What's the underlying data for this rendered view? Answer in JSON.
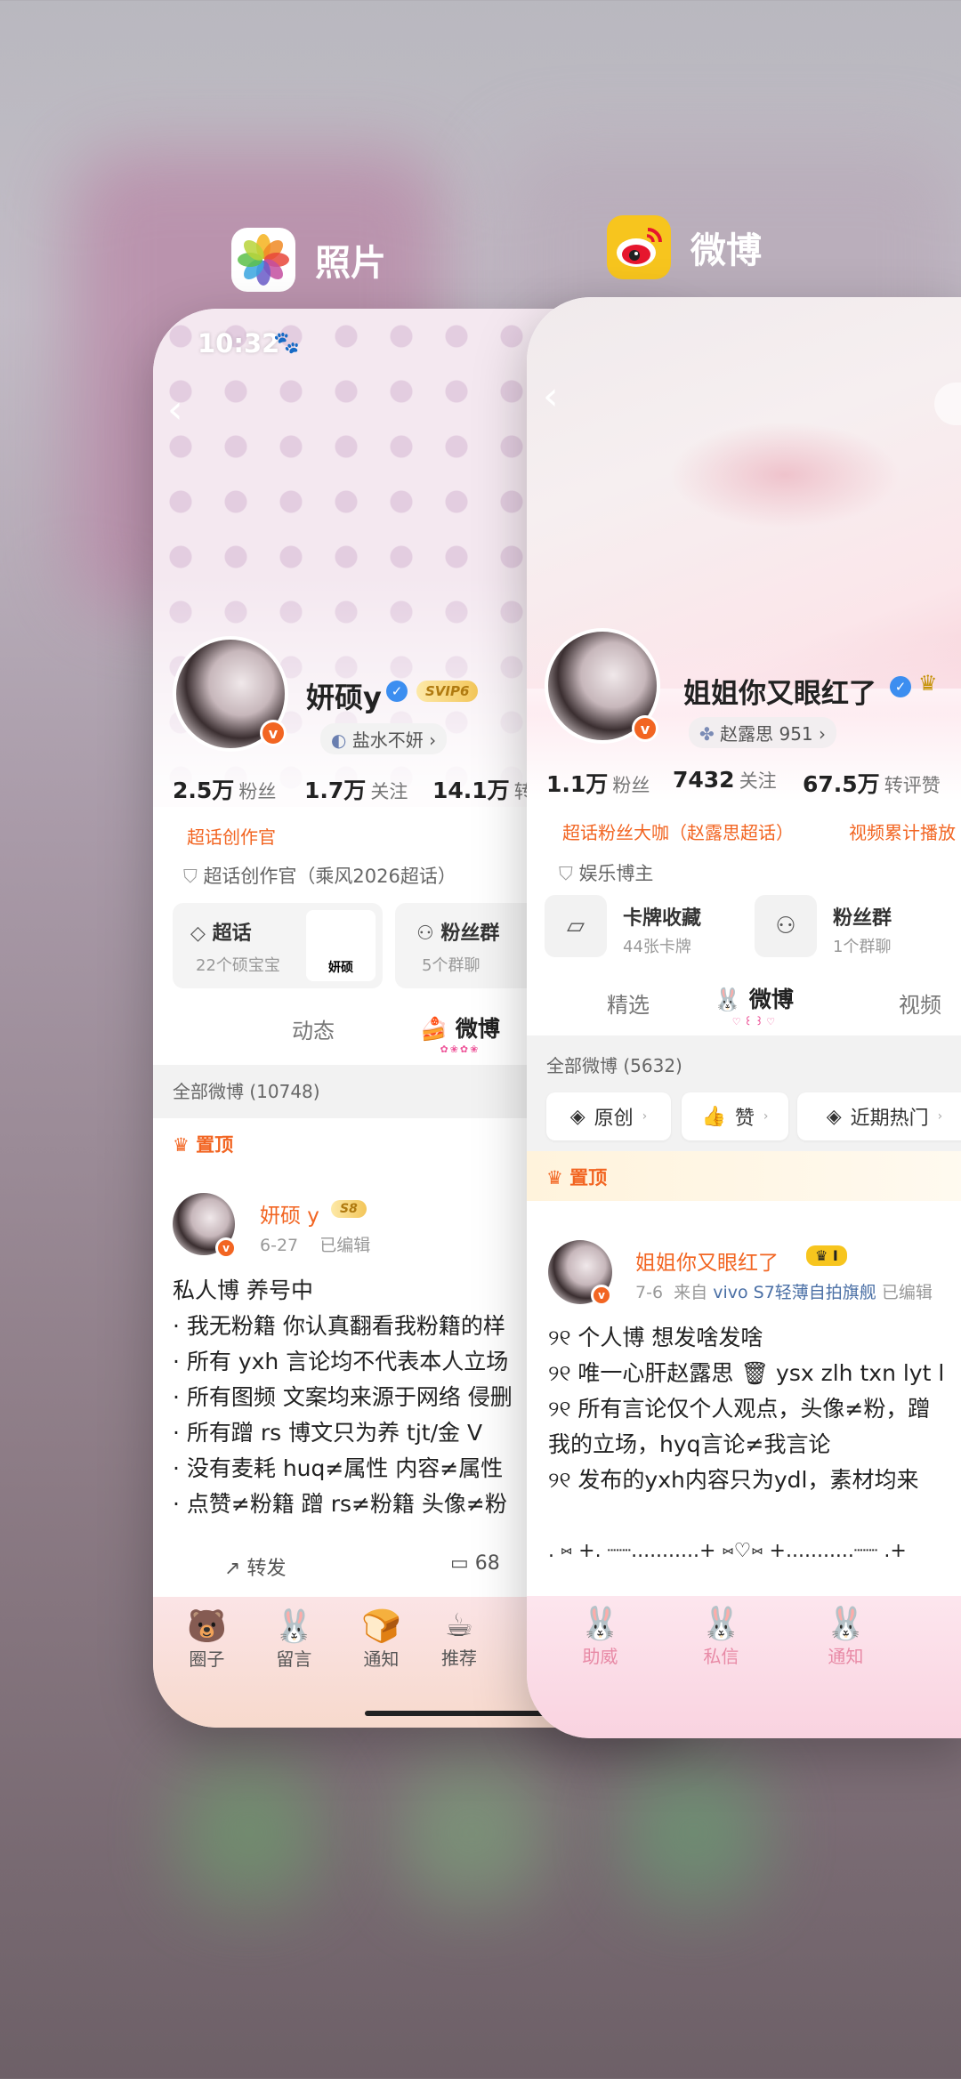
{
  "switcher": {
    "left_app_name": "照片",
    "right_app_name": "微博"
  },
  "left_card": {
    "status_time": "10:32",
    "profile": {
      "username": "妍硕y",
      "vip_badge": "SVIP6",
      "sub_link": "盐水不妍 ›",
      "stats": [
        {
          "value": "2.5万",
          "label": "粉丝"
        },
        {
          "value": "1.7万",
          "label": "关注"
        },
        {
          "value": "14.1万",
          "label": "转"
        }
      ],
      "tag": "超话创作官",
      "cert": "超话创作官（乘风2026超话）"
    },
    "cards": [
      {
        "title": "超话",
        "sub": "22个硕宝宝",
        "thumb": "妍硕"
      },
      {
        "title": "粉丝群",
        "sub": "5个群聊"
      }
    ],
    "tabs": [
      "动态",
      "微博"
    ],
    "all_weibo": "全部微博 (10748)",
    "pinned": "置顶",
    "post": {
      "author": "妍硕 y",
      "badge": "S8",
      "meta_date": "6-27",
      "meta_edited": "已编辑",
      "lines": [
        "私人博 养号中",
        "· 我无粉籍 你认真翻看我粉籍的样",
        "· 所有 yxh 言论均不代表本人立场",
        "· 所有图频 文案均来源于网络 侵删",
        "· 所有蹭 rs 博文只为养 tjt/金 V",
        "· 没有麦耗 huq≠属性 内容≠属性",
        "· 点赞≠粉籍 蹭 rs≠粉籍 头像≠粉"
      ],
      "repost_label": "转发",
      "comment_count": "68"
    },
    "bottom_nav": [
      "圈子",
      "留言",
      "通知",
      "推荐"
    ]
  },
  "right_card": {
    "profile": {
      "username": "姐姐你又眼红了",
      "sub_link": "赵露思 951 ›",
      "stats": [
        {
          "value": "1.1万",
          "label": "粉丝"
        },
        {
          "value": "7432",
          "label": "关注"
        },
        {
          "value": "67.5万",
          "label": "转评赞"
        }
      ],
      "tag1": "超话粉丝大咖（赵露思超话）",
      "tag2": "视频累计播放",
      "cert": "娱乐博主"
    },
    "cards": [
      {
        "title": "卡牌收藏",
        "sub": "44张卡牌"
      },
      {
        "title": "粉丝群",
        "sub": "1个群聊"
      }
    ],
    "tabs": [
      "精选",
      "微博",
      "视频"
    ],
    "all_weibo": "全部微博 (5632)",
    "filters": [
      "原创",
      "赞",
      "近期热门"
    ],
    "pinned": "置顶",
    "post": {
      "author": "姐姐你又眼红了",
      "badge_level": "I",
      "meta_date": "7-6",
      "meta_source_prefix": "来自",
      "meta_source": "vivo S7轻薄自拍旗舰",
      "meta_edited": "已编辑",
      "lines": [
        "୨୧ 个人博 想发啥发啥",
        "୨୧ 唯一心肝赵露思 🗑 ysx zlh txn lyt l",
        "୨୧ 所有言论仅个人观点，头像≠粉，蹭",
        "我的立场，hyq言论≠我言论",
        "୨୧ 发布的yxh内容只为ydl，素材均来"
      ],
      "divider": ". ⑅ +. ┈┈...........+ ⑅♡⑅ +...........┈┈ .+"
    },
    "bottom_nav": [
      "助威",
      "私信",
      "通知"
    ]
  }
}
